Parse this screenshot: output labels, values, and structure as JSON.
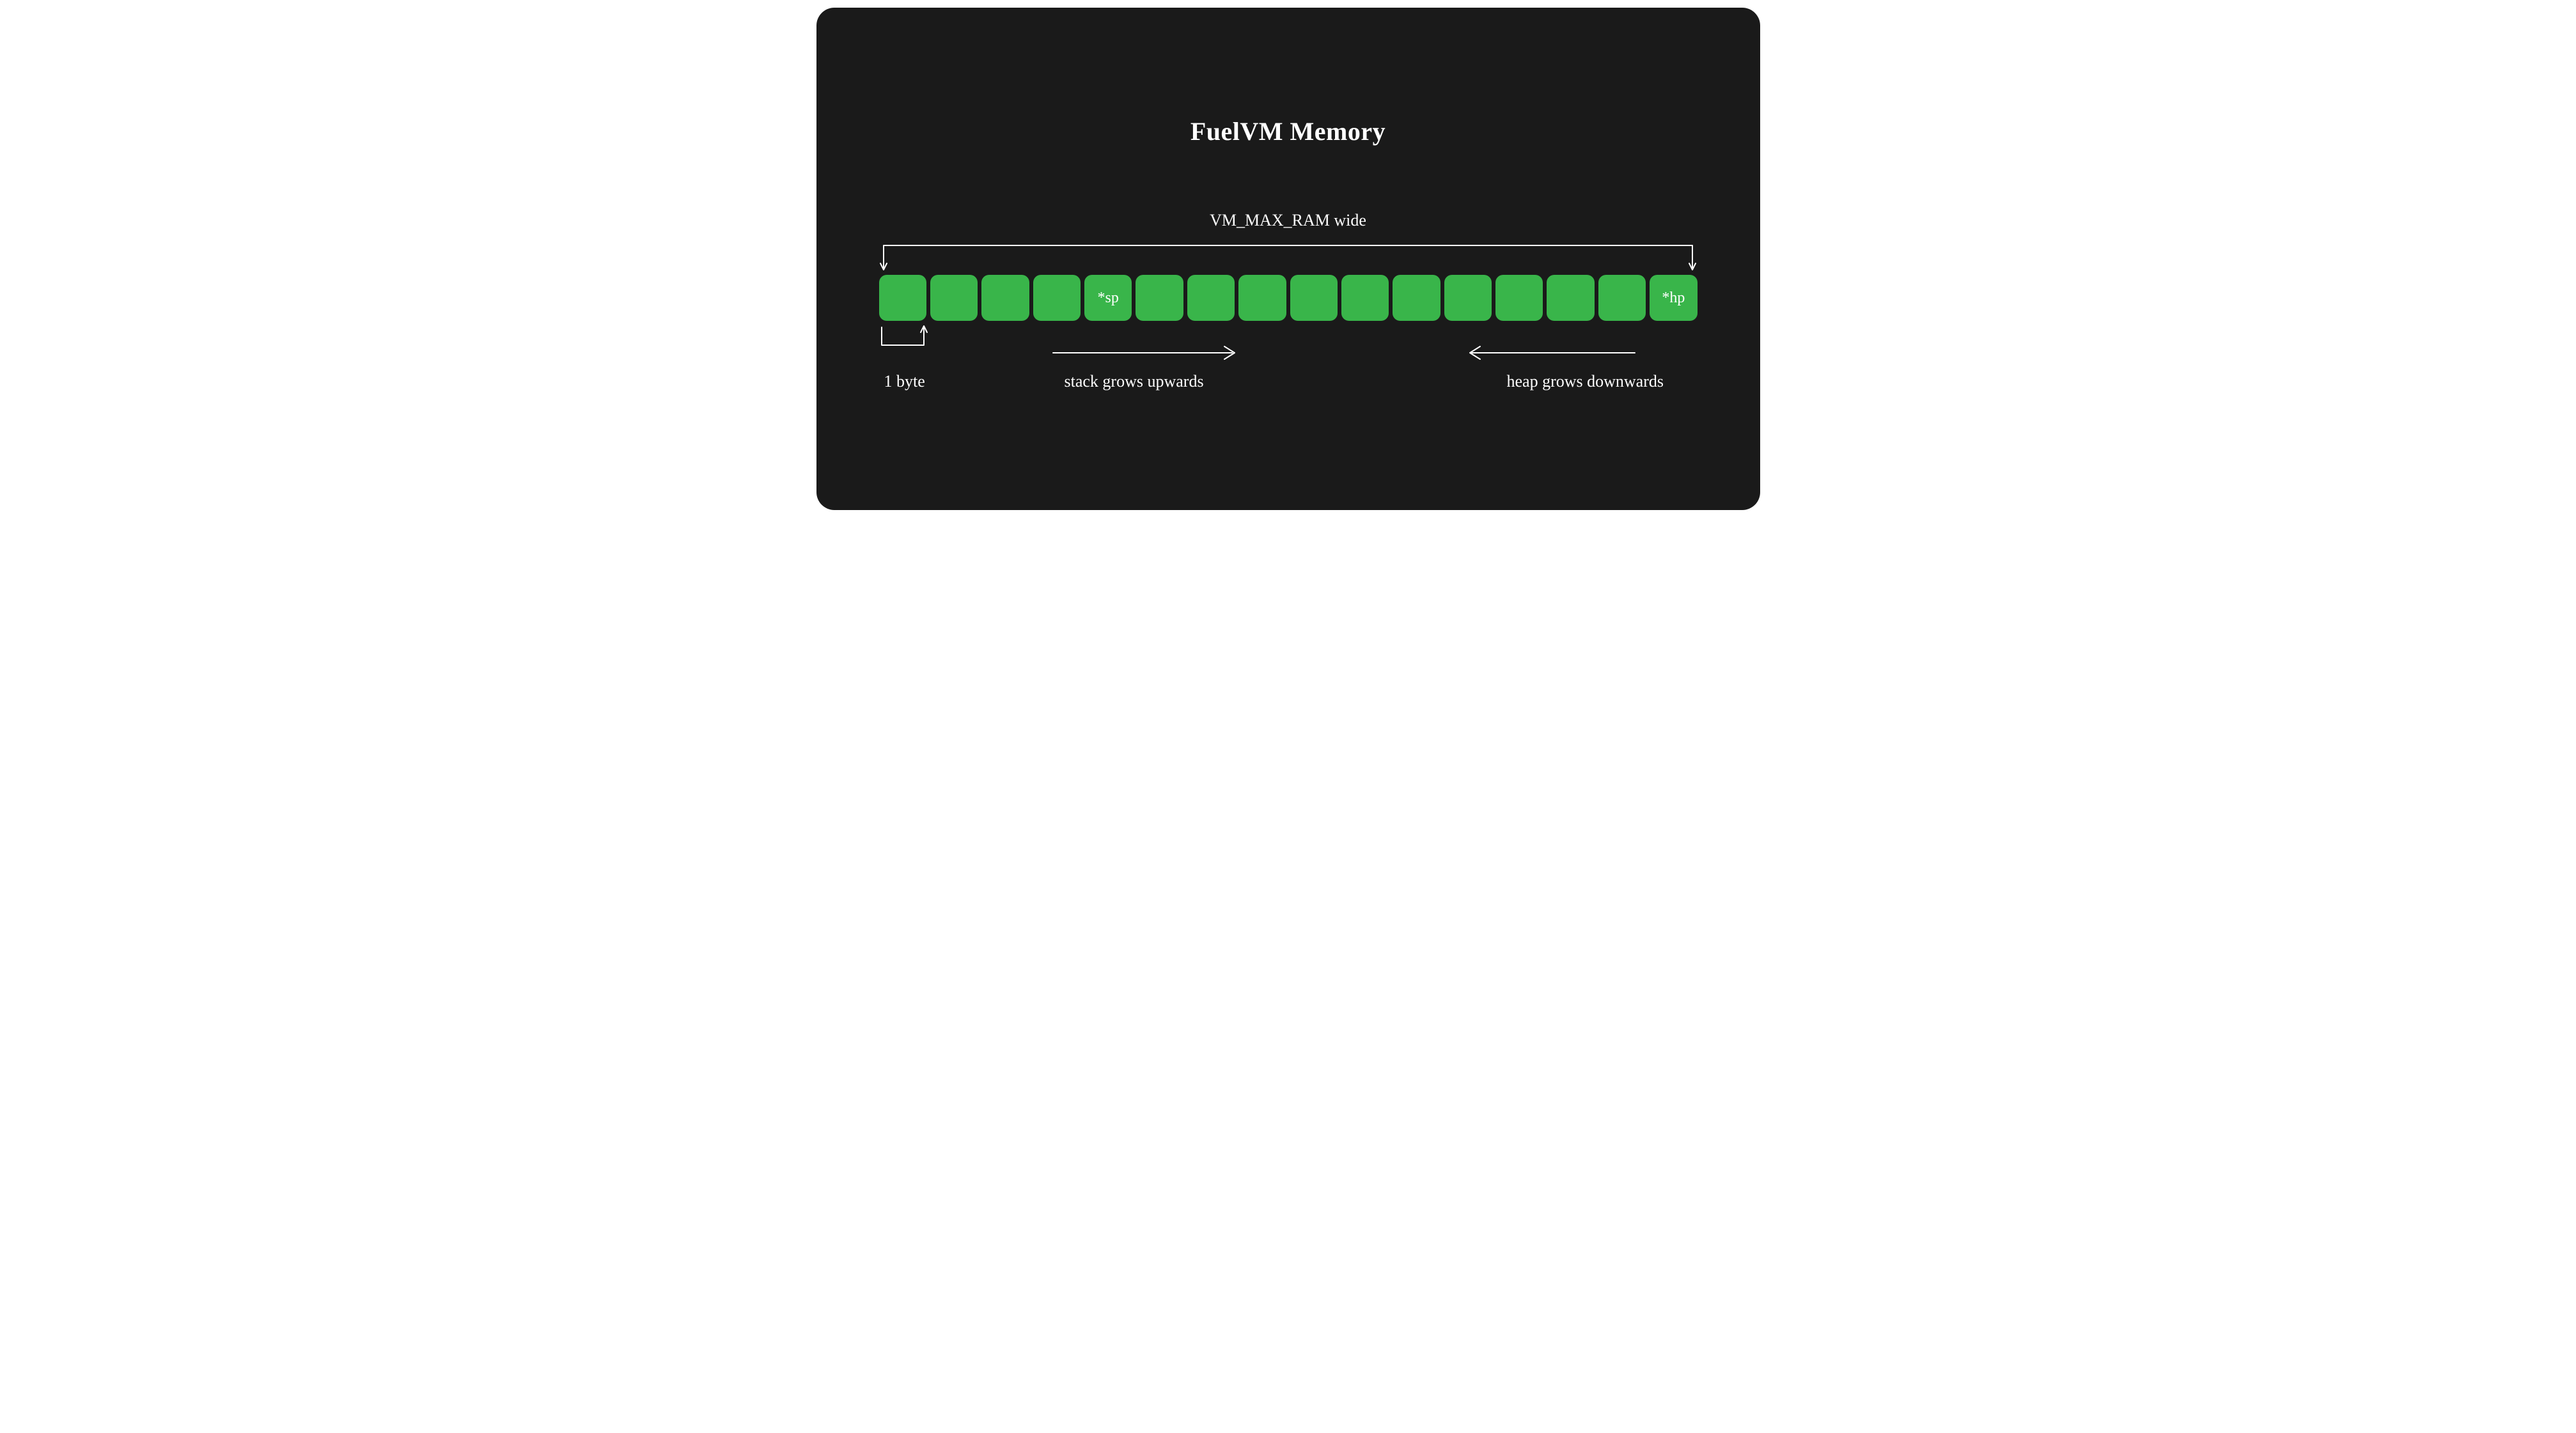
{
  "title": "FuelVM Memory",
  "top_label": "VM_MAX_RAM wide",
  "byte_label": "1 byte",
  "stack_label": "stack grows upwards",
  "heap_label": "heap grows downwards",
  "cells": {
    "count": 16,
    "sp_index": 4,
    "hp_index": 15,
    "sp_text": "*sp",
    "hp_text": "*hp"
  },
  "colors": {
    "cell": "#39b54a",
    "background": "#1a1a1a",
    "stroke": "#ffffff"
  }
}
